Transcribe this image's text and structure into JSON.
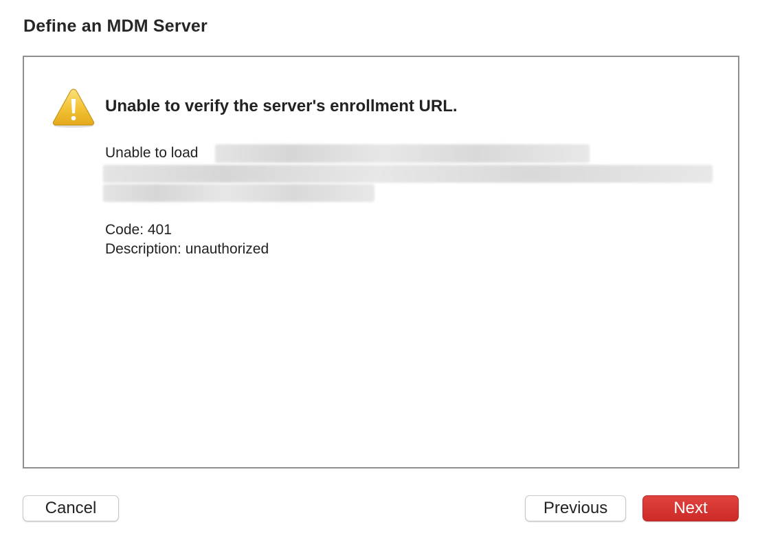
{
  "dialog": {
    "title": "Define an MDM Server"
  },
  "alert": {
    "icon": "warning-icon",
    "title": "Unable to verify the server's enrollment URL.",
    "load_label": "Unable to load",
    "code_line": "Code: 401",
    "description_line": "Description: unauthorized"
  },
  "buttons": {
    "cancel": "Cancel",
    "previous": "Previous",
    "next": "Next"
  },
  "colors": {
    "accent_next": "#d9312d",
    "warning_yellow": "#f2c234",
    "border": "#8e8e8e"
  }
}
